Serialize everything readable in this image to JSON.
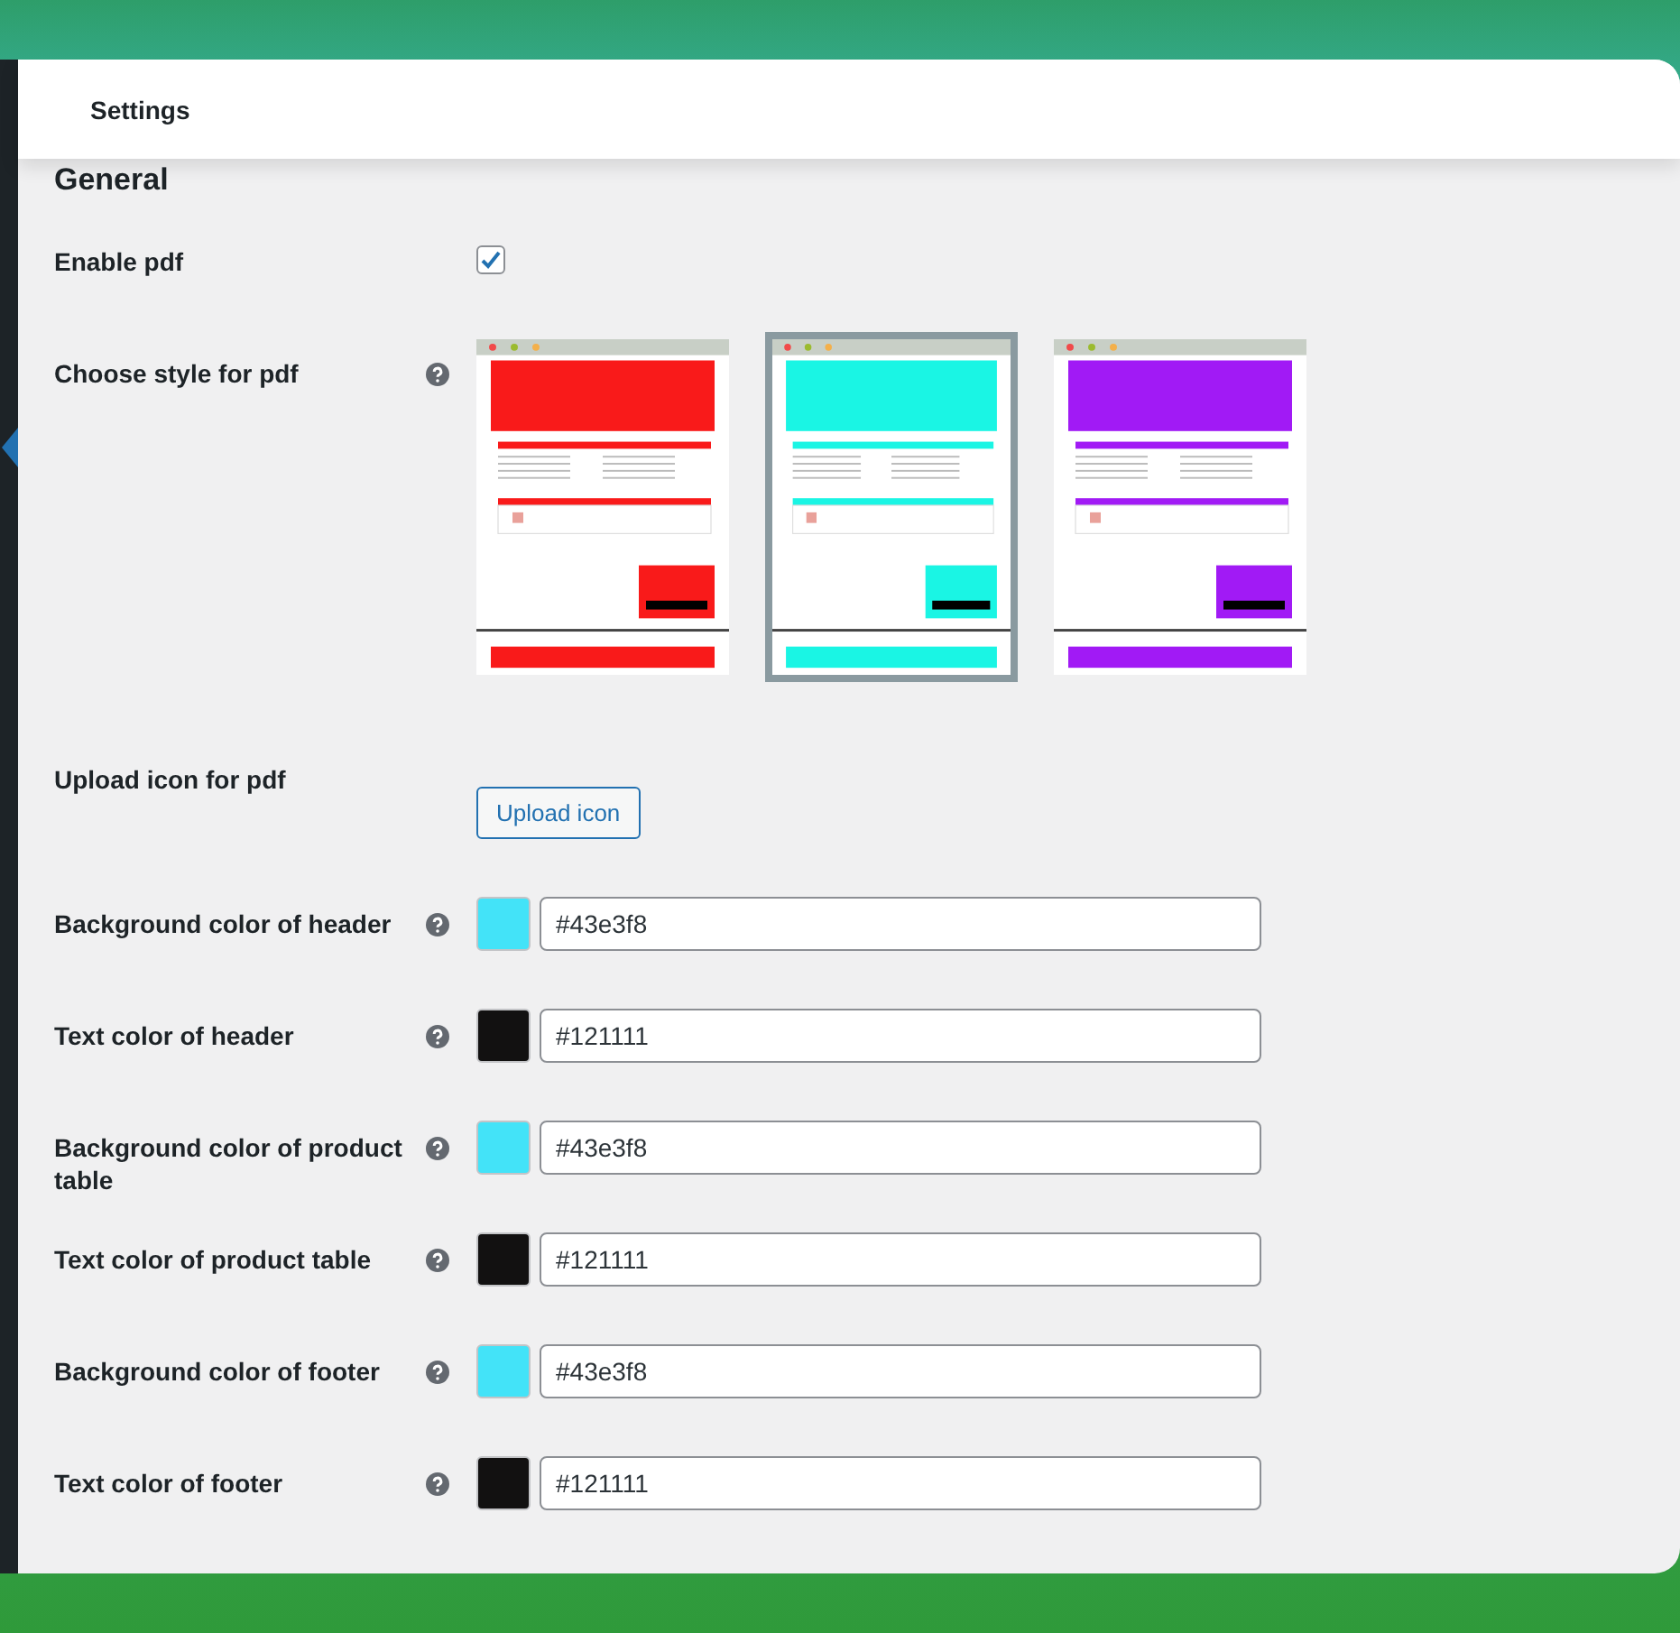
{
  "header": {
    "title": "Settings"
  },
  "section": {
    "title": "General"
  },
  "settings": [
    {
      "kind": "checkbox",
      "label": "Enable pdf",
      "help": false,
      "checked": true
    },
    {
      "kind": "styles",
      "label": "Choose style for pdf",
      "help": true,
      "styles": [
        {
          "color": "#f91a1a",
          "selected": false
        },
        {
          "color": "#1af5e4",
          "selected": true
        },
        {
          "color": "#a11af5",
          "selected": false
        }
      ]
    },
    {
      "kind": "upload",
      "label": "Upload icon for pdf",
      "help": false,
      "button": "Upload icon"
    },
    {
      "kind": "color",
      "label": "Background color of header",
      "help": true,
      "value": "#43e3f8",
      "color": "#43e3f8"
    },
    {
      "kind": "color",
      "label": "Text color of header",
      "help": true,
      "value": "#121111",
      "color": "#121111"
    },
    {
      "kind": "color",
      "label": "Background color of product table",
      "help": true,
      "value": "#43e3f8",
      "color": "#43e3f8"
    },
    {
      "kind": "color",
      "label": "Text color of product table",
      "help": true,
      "value": "#121111",
      "color": "#121111"
    },
    {
      "kind": "color",
      "label": "Background color of footer",
      "help": true,
      "value": "#43e3f8",
      "color": "#43e3f8"
    },
    {
      "kind": "color",
      "label": "Text color of footer",
      "help": true,
      "value": "#121111",
      "color": "#121111"
    }
  ]
}
